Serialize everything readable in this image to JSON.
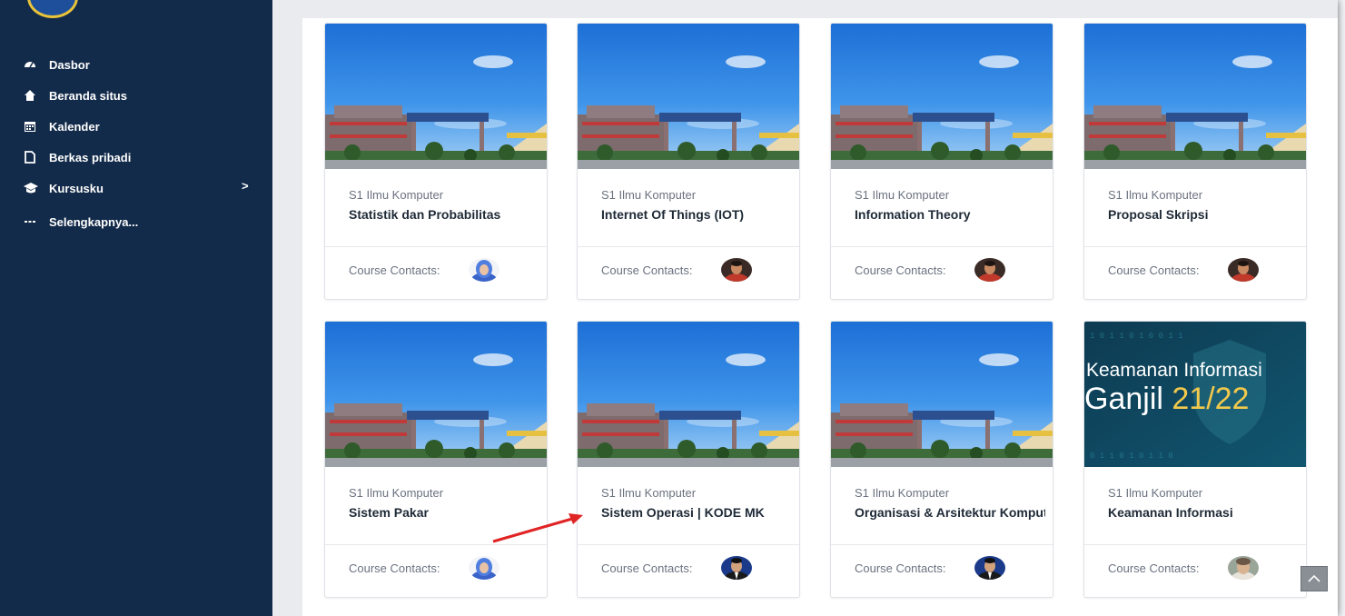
{
  "sidebar": {
    "items": [
      {
        "label": "Dasbor",
        "icon": "dashboard-icon"
      },
      {
        "label": "Beranda situs",
        "icon": "home-icon"
      },
      {
        "label": "Kalender",
        "icon": "calendar-icon"
      },
      {
        "label": "Berkas pribadi",
        "icon": "file-icon"
      },
      {
        "label": "Kursusku",
        "icon": "graduation-cap-icon",
        "chevron": ">"
      },
      {
        "label": "Selengkapnya...",
        "icon": "more-dots-icon"
      }
    ]
  },
  "courses": [
    {
      "category": "S1 Ilmu Komputer",
      "name": "Statistik dan Probabilitas",
      "contacts_label": "Course Contacts:",
      "image": "campus-photo",
      "avatar": "female-hijab-avatar"
    },
    {
      "category": "S1 Ilmu Komputer",
      "name": "Internet Of Things (IOT)",
      "contacts_label": "Course Contacts:",
      "image": "campus-photo",
      "avatar": "male-red-avatar"
    },
    {
      "category": "S1 Ilmu Komputer",
      "name": "Information Theory",
      "contacts_label": "Course Contacts:",
      "image": "campus-photo",
      "avatar": "male-red-avatar"
    },
    {
      "category": "S1 Ilmu Komputer",
      "name": "Proposal Skripsi",
      "contacts_label": "Course Contacts:",
      "image": "campus-photo",
      "avatar": "male-red-avatar"
    },
    {
      "category": "S1 Ilmu Komputer",
      "name": "Sistem Pakar",
      "contacts_label": "Course Contacts:",
      "image": "campus-photo",
      "avatar": "female-hijab-avatar"
    },
    {
      "category": "S1 Ilmu Komputer",
      "name": "Sistem Operasi | KODE MK",
      "contacts_label": "Course Contacts:",
      "image": "campus-photo",
      "avatar": "male-suit-avatar"
    },
    {
      "category": "S1 Ilmu Komputer",
      "name": "Organisasi & Arsitektur Komputer",
      "contacts_label": "Course Contacts:",
      "image": "campus-photo",
      "avatar": "male-suit-avatar"
    },
    {
      "category": "S1 Ilmu Komputer",
      "name": "Keamanan Informasi",
      "contacts_label": "Course Contacts:",
      "image": "security-banner",
      "image_text_1": "Keamanan Informasi",
      "image_text_2a": "Ganjil ",
      "image_text_2b": "21/22",
      "avatar": "female-outdoor-avatar"
    }
  ],
  "scroll_top": {
    "icon": "chevron-up-icon"
  },
  "colors": {
    "sidebar": "#132b4a",
    "accent_red": "#e02424",
    "banner_yellow": "#f2c94c"
  }
}
